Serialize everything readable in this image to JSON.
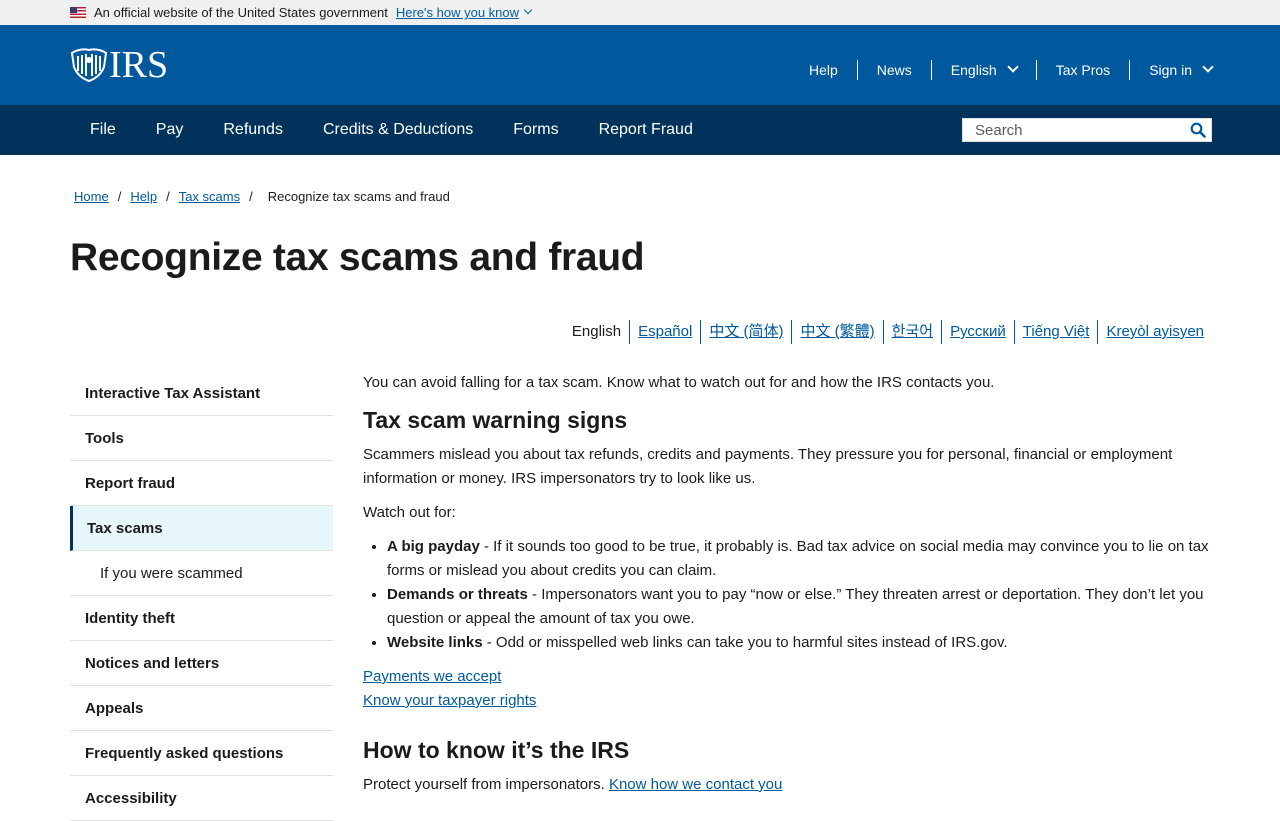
{
  "gov_banner": {
    "text": "An official website of the United States government",
    "how_link": "Here's how you know"
  },
  "header": {
    "logo_text": "IRS",
    "util_nav": [
      {
        "label": "Help"
      },
      {
        "label": "News"
      },
      {
        "label": "English"
      },
      {
        "label": "Tax Pros"
      },
      {
        "label": "Sign in"
      }
    ]
  },
  "main_nav": {
    "items": [
      "File",
      "Pay",
      "Refunds",
      "Credits & Deductions",
      "Forms",
      "Report Fraud"
    ],
    "search_placeholder": "Search"
  },
  "breadcrumb": {
    "items": [
      "Home",
      "Help",
      "Tax scams"
    ],
    "current": "Recognize tax scams and fraud"
  },
  "page_title": "Recognize tax scams and fraud",
  "languages": {
    "active": "English",
    "links": [
      "Español",
      "中文 (简体)",
      "中文 (繁體)",
      "한국어",
      "Русский",
      "Tiếng Việt",
      "Kreyòl ayisyen"
    ]
  },
  "sidenav": [
    "Interactive Tax Assistant",
    "Tools",
    "Report fraud",
    "Tax scams",
    "If you were scammed",
    "Identity theft",
    "Notices and letters",
    "Appeals",
    "Frequently asked questions",
    "Accessibility"
  ],
  "content": {
    "intro": "You can avoid falling for a tax scam. Know what to watch out for and how the IRS contacts you.",
    "h2_warning": "Tax scam warning signs",
    "warning_para": "Scammers mislead you about tax refunds, credits and payments. They pressure you for personal, financial or employment information or money. IRS impersonators try to look like us.",
    "watch_out": "Watch out for:",
    "bullets": [
      {
        "bold": "A big payday",
        "text": " - If it sounds too good to be true, it probably is. Bad tax advice on social media may convince you to lie on tax forms or mislead you about credits you can claim."
      },
      {
        "bold": "Demands or threats",
        "text": " - Impersonators want you to pay “now or else.” They threaten arrest or deportation. They don’t let you question or appeal the amount of tax you owe."
      },
      {
        "bold": "Website links",
        "text": " - Odd or misspelled web links can take you to harmful sites instead of IRS.gov."
      }
    ],
    "link_payments": "Payments we accept",
    "link_rights": "Know your taxpayer rights",
    "h2_irs": "How to know it’s the IRS",
    "protect_text": "Protect yourself from impersonators.",
    "protect_link": "Know how we contact you"
  },
  "colors": {
    "header_blue": "#00599c",
    "nav_dark_blue": "#00325b",
    "banner_gray": "#f0f0f0",
    "active_nav_bg": "#e7f6f8",
    "link_blue": "#00599c"
  }
}
